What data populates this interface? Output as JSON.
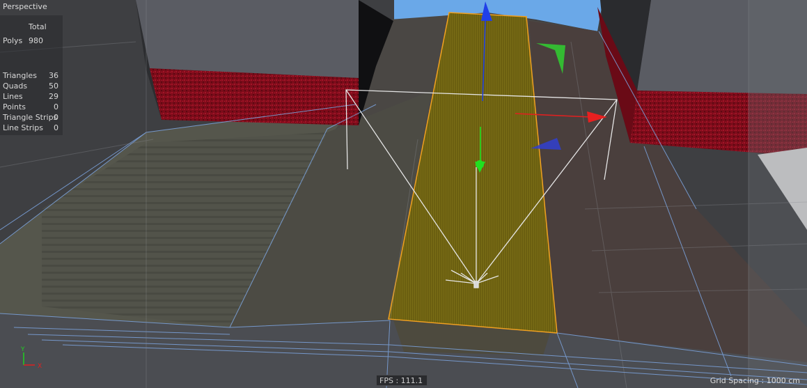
{
  "viewport": {
    "name": "Perspective",
    "fps_label": "FPS : 111.1",
    "grid_spacing_label": "Grid Spacing : 1000 cm"
  },
  "stats": {
    "total_header": "Total",
    "polys": {
      "label": "Polys",
      "value": "980"
    },
    "rows": [
      {
        "label": "Triangles",
        "value": "36"
      },
      {
        "label": "Quads",
        "value": "50"
      },
      {
        "label": "Lines",
        "value": "29"
      },
      {
        "label": "Points",
        "value": "0"
      },
      {
        "label": "Triangle Strips",
        "value": "0"
      },
      {
        "label": "Line Strips",
        "value": "0"
      }
    ]
  },
  "axis_indicator": {
    "y": "Y",
    "x": "X"
  },
  "colors": {
    "selection": "#f0a020",
    "road_fill": "#6f6312",
    "axis_x": "#e02020",
    "axis_y": "#20e020",
    "axis_z": "#2040e0",
    "wall": "#8a0e1e",
    "sky": "#6aa8e8"
  },
  "icons": {
    "move_gizmo": "move-gizmo-icon",
    "camera_frustum": "light-cone-icon",
    "axis_indicator": "world-axis-icon"
  }
}
